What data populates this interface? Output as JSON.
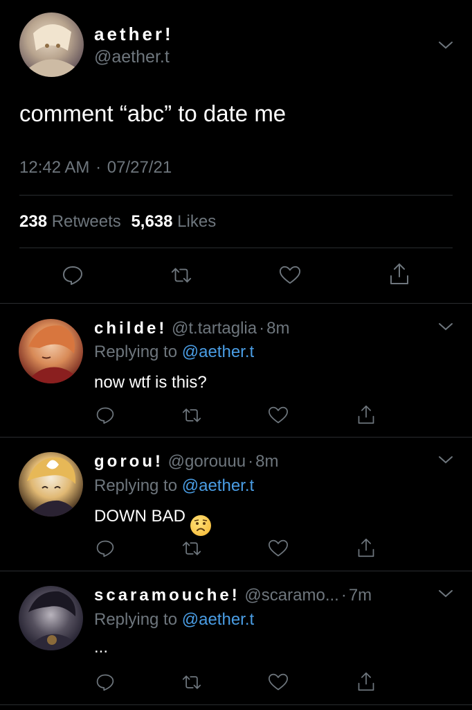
{
  "main_tweet": {
    "display_name": "aether!",
    "handle": "@aether.t",
    "text": "comment “abc” to date me",
    "time": "12:42 AM",
    "date": "07/27/21",
    "retweets_count": "238",
    "retweets_label": "Retweets",
    "likes_count": "5,638",
    "likes_label": "Likes"
  },
  "replies": [
    {
      "display_name": "childe!",
      "handle": "@t.tartaglia",
      "time": "8m",
      "replying_prefix": "Replying to",
      "replying_handle": "@aether.t",
      "text": "now wtf is this?"
    },
    {
      "display_name": "gorou!",
      "handle": "@gorouuu",
      "time": "8m",
      "replying_prefix": "Replying to",
      "replying_handle": "@aether.t",
      "text": "DOWN BAD",
      "emoji": "😟"
    },
    {
      "display_name": "scaramouche!",
      "handle": "@scaramo...",
      "time": "7m",
      "replying_prefix": "Replying to",
      "replying_handle": "@aether.t",
      "text": "..."
    }
  ],
  "separator": "·",
  "colors": {
    "background": "#000000",
    "secondary_text": "#6e767d",
    "link": "#4a9de4",
    "divider": "#2a2d30"
  },
  "icons": [
    "chevron-down-icon",
    "reply-icon",
    "retweet-icon",
    "like-icon",
    "share-icon"
  ]
}
